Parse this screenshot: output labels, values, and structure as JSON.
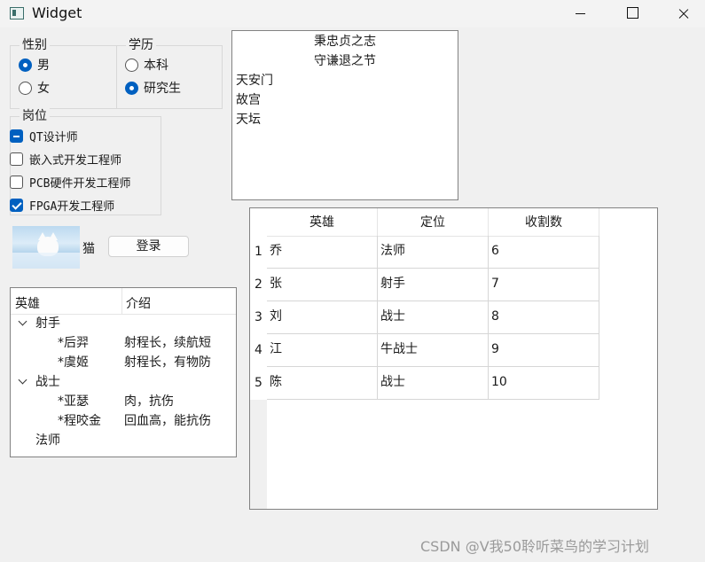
{
  "window": {
    "title": "Widget"
  },
  "gender_group": {
    "title": "性别",
    "options": [
      {
        "label": "男",
        "selected": true
      },
      {
        "label": "女",
        "selected": false
      }
    ]
  },
  "education_group": {
    "title": "学历",
    "options": [
      {
        "label": "本科",
        "selected": false
      },
      {
        "label": "研究生",
        "selected": true
      }
    ]
  },
  "position_group": {
    "title": "岗位",
    "options": [
      {
        "label": "QT设计师",
        "state": "partial"
      },
      {
        "label": "嵌入式开发工程师",
        "state": "unchecked"
      },
      {
        "label": "PCB硬件开发工程师",
        "state": "unchecked"
      },
      {
        "label": "FPGA开发工程师",
        "state": "checked"
      }
    ]
  },
  "image_label": "猫",
  "login_button": "登录",
  "tree": {
    "headers": [
      "英雄",
      "介绍"
    ],
    "rows": [
      {
        "text": "射手",
        "desc": "",
        "level": 0,
        "expanded": true
      },
      {
        "text": "*后羿",
        "desc": "射程长，续航短",
        "level": 1
      },
      {
        "text": "*虞姬",
        "desc": "射程长，有物防",
        "level": 1
      },
      {
        "text": "战士",
        "desc": "",
        "level": 0,
        "expanded": true
      },
      {
        "text": "*亚瑟",
        "desc": "肉，抗伤",
        "level": 1
      },
      {
        "text": "*程咬金",
        "desc": "回血高，能抗伤",
        "level": 1
      },
      {
        "text": "法师",
        "desc": "",
        "level": 0,
        "expanded": false
      }
    ]
  },
  "text_view": {
    "centered_lines": [
      "秉忠贞之志",
      "守谦退之节"
    ],
    "lines": [
      "天安门",
      "故宫",
      "天坛"
    ]
  },
  "table": {
    "headers": [
      "英雄",
      "定位",
      "收割数"
    ],
    "rows": [
      {
        "index": "1",
        "cells": [
          "乔",
          "法师",
          "6"
        ]
      },
      {
        "index": "2",
        "cells": [
          "张",
          "射手",
          "7"
        ]
      },
      {
        "index": "3",
        "cells": [
          "刘",
          "战士",
          "8"
        ]
      },
      {
        "index": "4",
        "cells": [
          "江",
          "牛战士",
          "9"
        ]
      },
      {
        "index": "5",
        "cells": [
          "陈",
          "战士",
          "10"
        ]
      }
    ]
  },
  "watermark": "CSDN @V我50聆听菜鸟的学习计划",
  "colors": {
    "accent": "#0060c0",
    "background": "#f0f0f0",
    "border": "#828282"
  }
}
